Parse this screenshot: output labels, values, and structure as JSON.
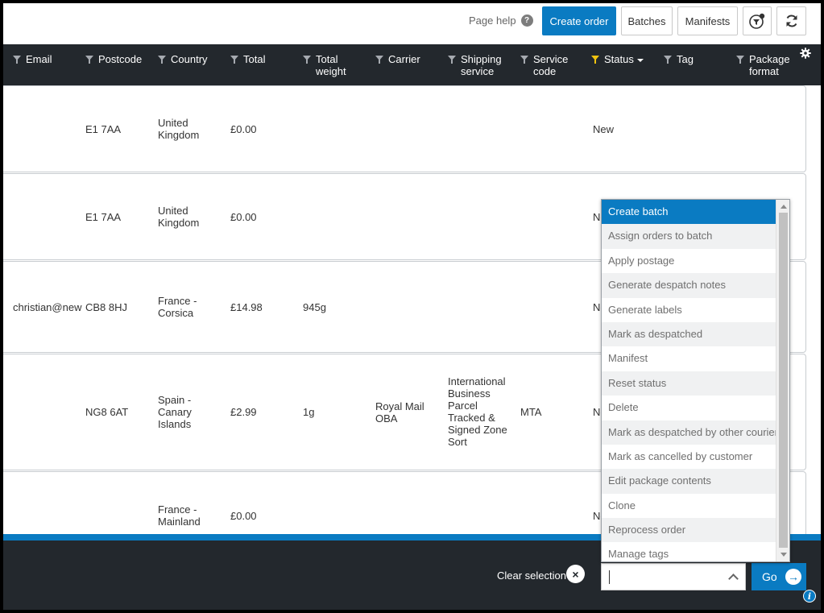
{
  "toolbar": {
    "page_help": "Page help",
    "help_icon": "?",
    "create_order": "Create order",
    "batches": "Batches",
    "manifests": "Manifests",
    "filter_settings_icon": "filter-settings-icon",
    "refresh_icon": "refresh-icon"
  },
  "columns": {
    "email": "Email",
    "postcode": "Postcode",
    "country": "Country",
    "total": "Total",
    "total_weight_1": "Total",
    "total_weight_2": "weight",
    "carrier": "Carrier",
    "shipping_1": "Shipping",
    "shipping_2": "service",
    "service_1": "Service",
    "service_2": "code",
    "status": "Status",
    "tag": "Tag",
    "package_1": "Package",
    "package_2": "format"
  },
  "rows": [
    {
      "email": "",
      "postcode": "E1 7AA",
      "country": [
        "United",
        "Kingdom"
      ],
      "total": "£0.00",
      "weight": "",
      "carrier": [],
      "shipping": [],
      "service": "",
      "status": "New"
    },
    {
      "email": "",
      "postcode": "E1 7AA",
      "country": [
        "United",
        "Kingdom"
      ],
      "total": "£0.00",
      "weight": "",
      "carrier": [],
      "shipping": [],
      "service": "",
      "status": "Ne"
    },
    {
      "email": "christian@new",
      "postcode": "CB8 8HJ",
      "country": [
        "France -",
        "Corsica"
      ],
      "total": "£14.98",
      "weight": "945g",
      "carrier": [],
      "shipping": [],
      "service": "",
      "status": "Ne"
    },
    {
      "email": "",
      "postcode": "NG8 6AT",
      "country": [
        "Spain -",
        "Canary",
        "Islands"
      ],
      "total": "£2.99",
      "weight": "1g",
      "carrier": [
        "Royal Mail",
        "OBA"
      ],
      "shipping": [
        "International",
        "Business",
        "Parcel",
        "Tracked &",
        "Signed Zone",
        "Sort"
      ],
      "service": "MTA",
      "status": "Ne"
    },
    {
      "email": "",
      "postcode": "",
      "country": [
        "France -",
        "Mainland"
      ],
      "total": "£0.00",
      "weight": "",
      "carrier": [],
      "shipping": [],
      "service": "",
      "status": "Ne"
    }
  ],
  "actions": {
    "items": [
      "Create batch",
      "Assign orders to batch",
      "Apply postage",
      "Generate despatch notes",
      "Generate labels",
      "Mark as despatched",
      "Manifest",
      "Reset status",
      "Delete",
      "Mark as despatched by other courier",
      "Mark as cancelled by customer",
      "Edit package contents",
      "Clone",
      "Reprocess order",
      "Manage tags"
    ],
    "selected_index": 0,
    "input_value": ""
  },
  "bottom": {
    "clear_selection": "Clear selection",
    "clear_icon": "×",
    "go": "Go",
    "go_icon": "→",
    "info_icon": "i"
  },
  "colors": {
    "accent": "#0a7bc2",
    "header_bg": "#23282d",
    "active_filter": "#f1c40f"
  }
}
